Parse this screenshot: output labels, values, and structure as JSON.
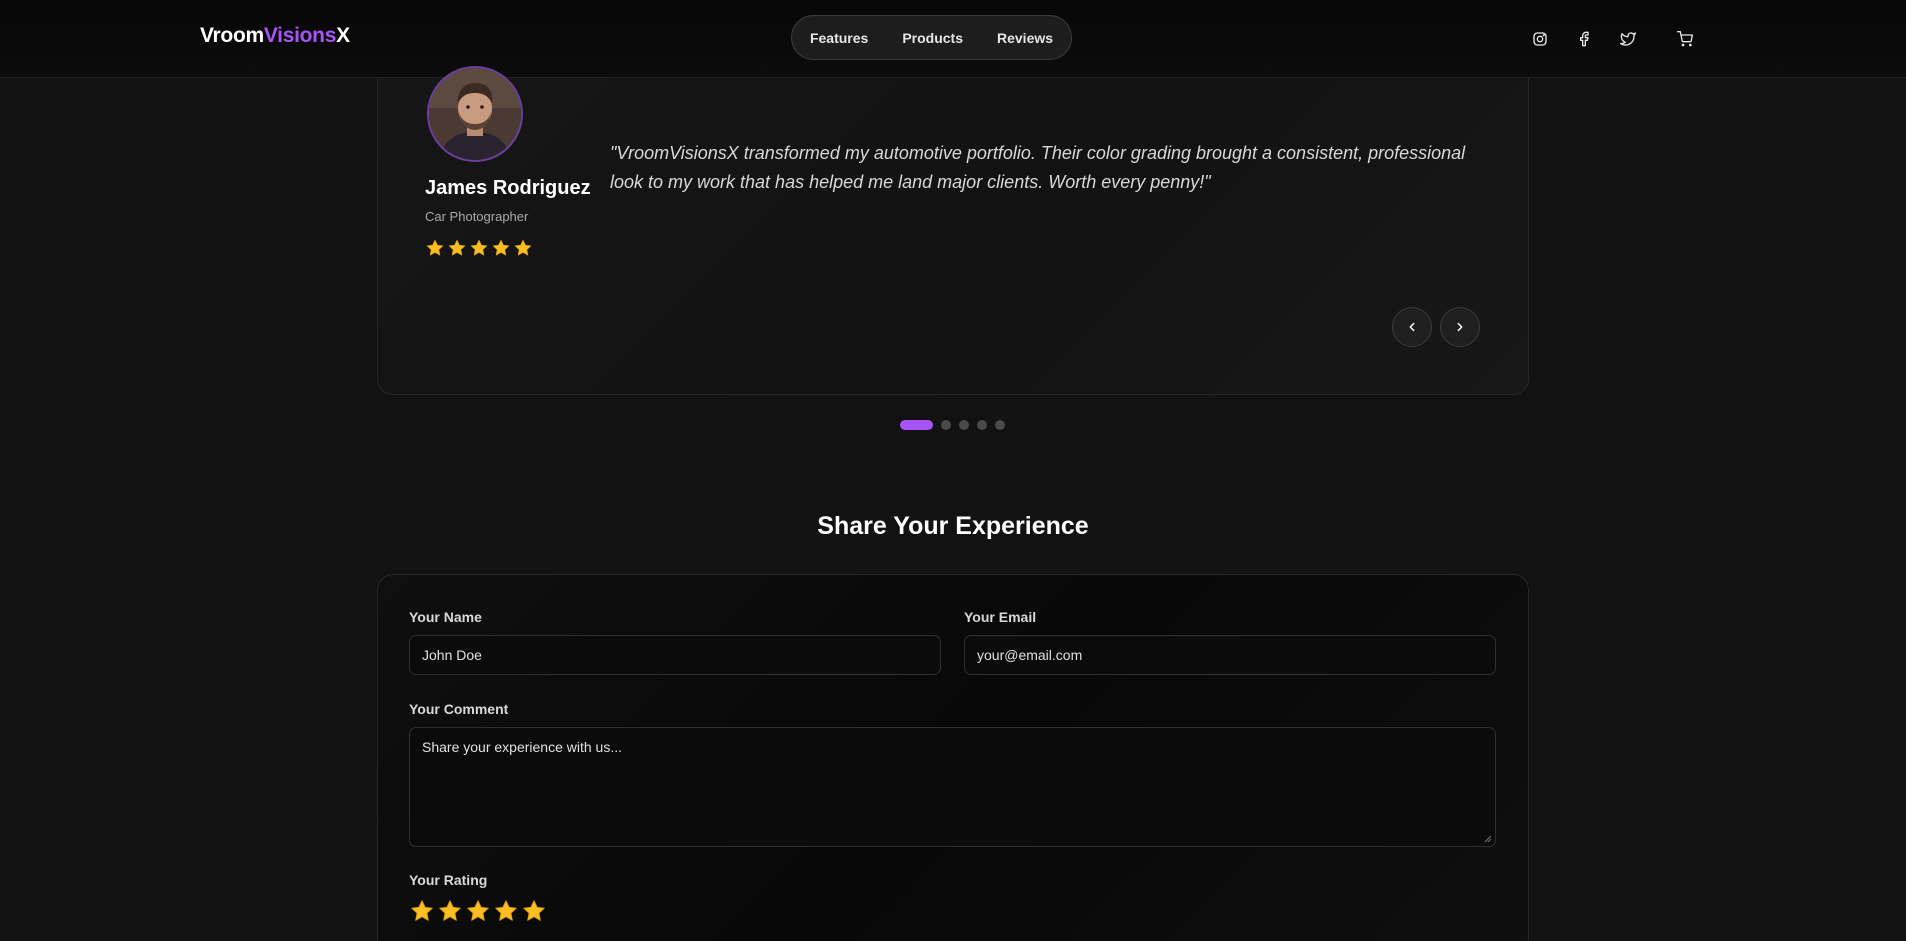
{
  "header": {
    "brand_part1": "Vroom",
    "brand_part2": "Visions",
    "brand_part3": "X",
    "nav": [
      "Features",
      "Products",
      "Reviews"
    ],
    "icons": [
      "instagram-icon",
      "facebook-icon",
      "twitter-icon",
      "cart-icon"
    ]
  },
  "testimonial": {
    "name": "James Rodriguez",
    "role": "Car Photographer",
    "rating": 5,
    "quote": "\"VroomVisionsX transformed my automotive portfolio. Their color grading brought a consistent, professional look to my work that has helped me land major clients. Worth every penny!\"",
    "slide_count": 5,
    "active_slide": 1
  },
  "share": {
    "title": "Share Your Experience",
    "name_label": "Your Name",
    "name_placeholder": "John Doe",
    "email_label": "Your Email",
    "email_placeholder": "your@email.com",
    "comment_label": "Your Comment",
    "comment_placeholder": "Share your experience with us...",
    "rating_label": "Your Rating",
    "rating": 5
  },
  "colors": {
    "accent": "#a855f7",
    "star": "#fbbf24",
    "background": "#121212"
  }
}
